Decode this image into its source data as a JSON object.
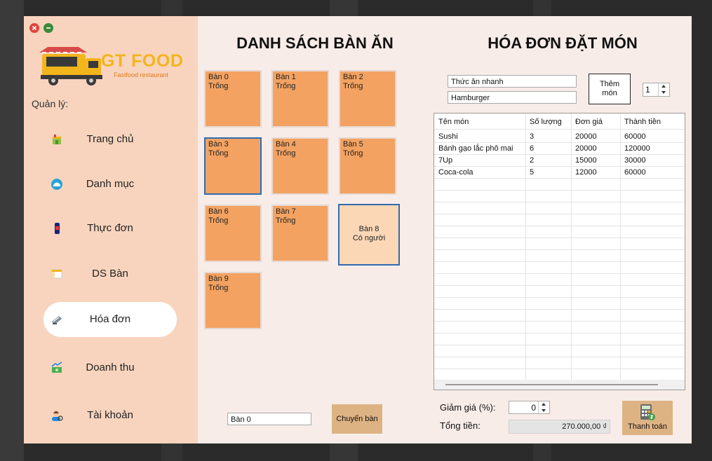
{
  "sidebar": {
    "logo_title": "GT FOOD",
    "logo_subtitle": "Fastfood restaurant",
    "section_label": "Quản lý:",
    "items": [
      {
        "label": "Trang chủ",
        "icon": "home-icon"
      },
      {
        "label": "Danh mục",
        "icon": "category-icon"
      },
      {
        "label": "Thực đơn",
        "icon": "menu-icon"
      },
      {
        "label": "DS Bàn",
        "icon": "table-list-icon"
      },
      {
        "label": "Hóa đơn",
        "icon": "invoice-icon",
        "active": true
      },
      {
        "label": "Doanh thu",
        "icon": "revenue-icon"
      },
      {
        "label": "Tài khoản",
        "icon": "account-icon"
      }
    ]
  },
  "tables_panel": {
    "title": "DANH SÁCH BÀN ĂN",
    "tables": [
      {
        "name": "Bàn 0",
        "status": "Trống"
      },
      {
        "name": "Bàn 1",
        "status": "Trống"
      },
      {
        "name": "Bàn 2",
        "status": "Trống"
      },
      {
        "name": "Bàn 3",
        "status": "Trống"
      },
      {
        "name": "Bàn 4",
        "status": "Trống"
      },
      {
        "name": "Bàn 5",
        "status": "Trống"
      },
      {
        "name": "Bàn 6",
        "status": "Trống"
      },
      {
        "name": "Bàn 7",
        "status": "Trống"
      },
      {
        "name": "Bàn 8",
        "status": "Có người"
      },
      {
        "name": "Bàn 9",
        "status": "Trống"
      }
    ],
    "switch_table_value": "Bàn 0",
    "switch_button": "Chuyển bàn"
  },
  "order_panel": {
    "title": "HÓA ĐƠN ĐẶT MÓN",
    "category_value": "Thức ăn nhanh",
    "food_value": "Hamburger",
    "add_button": "Thêm món",
    "quantity": "1",
    "columns": [
      "Tên món",
      "Số lượng",
      "Đơn giá",
      "Thành tiền"
    ],
    "rows": [
      [
        "Sushi",
        "3",
        "20000",
        "60000"
      ],
      [
        "Bánh gạo lắc phô mai",
        "6",
        "20000",
        "120000"
      ],
      [
        "7Up",
        "2",
        "15000",
        "30000"
      ],
      [
        "Coca-cola",
        "5",
        "12000",
        "60000"
      ]
    ],
    "discount_label": "Giảm giá (%):",
    "discount_value": "0",
    "total_label": "Tổng tiền:",
    "total_value": "270.000,00 ₫",
    "pay_button": "Thanh toán"
  },
  "colors": {
    "sidebar_bg": "#f8d4be",
    "table_free": "#f3a261",
    "table_busy": "#fcd7b6",
    "button_tan": "#deb383",
    "logo_yellow": "#f2b51c"
  }
}
